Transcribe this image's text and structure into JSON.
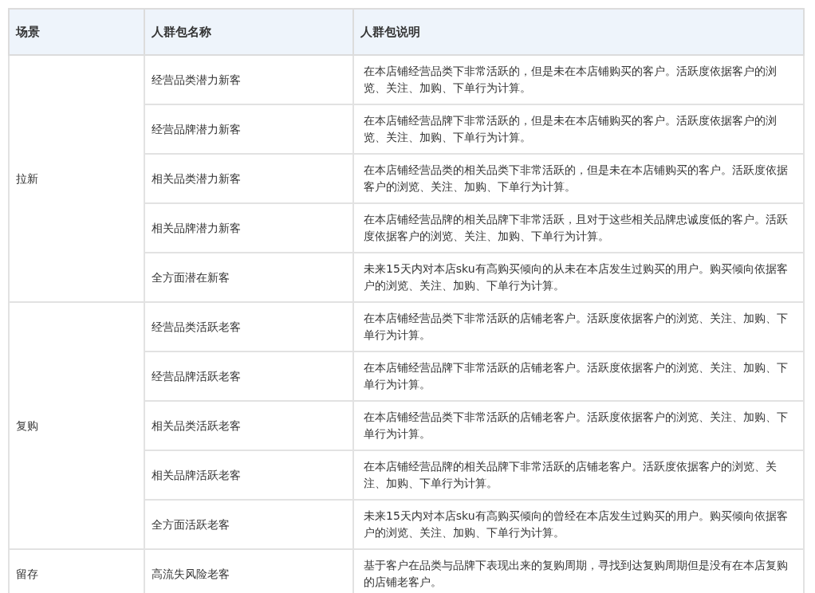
{
  "table": {
    "columns": [
      "场景",
      "人群包名称",
      "人群包说明"
    ],
    "groups": [
      {
        "scene": "拉新",
        "rows": [
          {
            "name": "经营品类潜力新客",
            "description": "在本店铺经营品类下非常活跃的，但是未在本店铺购买的客户。活跃度依据客户的浏览、关注、加购、下单行为计算。"
          },
          {
            "name": "经营品牌潜力新客",
            "description": "在本店铺经营品牌下非常活跃的，但是未在本店铺购买的客户。活跃度依据客户的浏览、关注、加购、下单行为计算。"
          },
          {
            "name": "相关品类潜力新客",
            "description": "在本店铺经营品类的相关品类下非常活跃的，但是未在本店铺购买的客户。活跃度依据客户的浏览、关注、加购、下单行为计算。"
          },
          {
            "name": "相关品牌潜力新客",
            "description": "在本店铺经营品牌的相关品牌下非常活跃，且对于这些相关品牌忠诚度低的客户。活跃度依据客户的浏览、关注、加购、下单行为计算。"
          },
          {
            "name": "全方面潜在新客",
            "description": "未来15天内对本店sku有高购买倾向的从未在本店发生过购买的用户。购买倾向依据客户的浏览、关注、加购、下单行为计算。"
          }
        ]
      },
      {
        "scene": "复购",
        "rows": [
          {
            "name": "经营品类活跃老客",
            "description": "在本店铺经营品类下非常活跃的店铺老客户。活跃度依据客户的浏览、关注、加购、下单行为计算。"
          },
          {
            "name": "经营品牌活跃老客",
            "description": "在本店铺经营品牌下非常活跃的店铺老客户。活跃度依据客户的浏览、关注、加购、下单行为计算。"
          },
          {
            "name": "相关品类活跃老客",
            "description": "在本店铺经营品类下非常活跃的店铺老客户。活跃度依据客户的浏览、关注、加购、下单行为计算。"
          },
          {
            "name": "相关品牌活跃老客",
            "description": "在本店铺经营品牌的相关品牌下非常活跃的店铺老客户。活跃度依据客户的浏览、关注、加购、下单行为计算。"
          },
          {
            "name": "全方面活跃老客",
            "description": "未来15天内对本店sku有高购买倾向的曾经在本店发生过购买的用户。购买倾向依据客户的浏览、关注、加购、下单行为计算。"
          }
        ]
      },
      {
        "scene": "留存",
        "rows": [
          {
            "name": "高流失风险老客",
            "description": "基于客户在品类与品牌下表现出来的复购周期，寻找到达复购周期但是没有在本店复购的店铺老客户。"
          }
        ]
      }
    ]
  }
}
